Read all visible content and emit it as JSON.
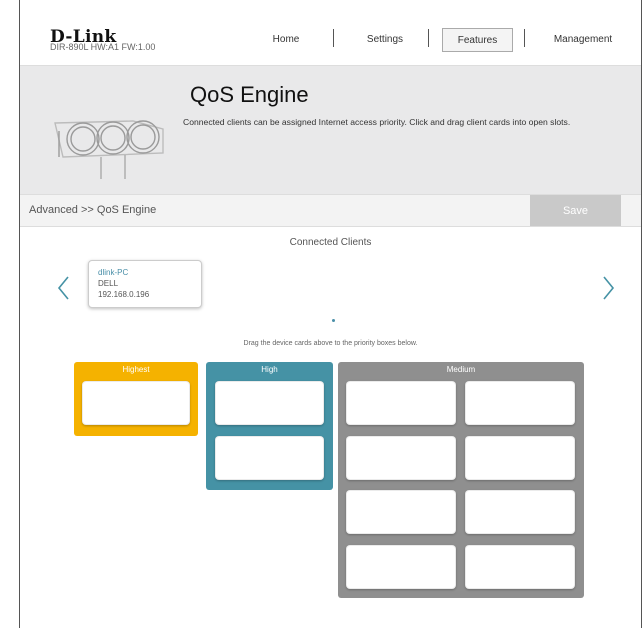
{
  "header": {
    "brand": "D-Link",
    "model_info": "DIR-890L   HW:A1   FW:1.00",
    "nav": [
      {
        "label": "Home"
      },
      {
        "label": "Settings"
      },
      {
        "label": "Features",
        "active": true
      },
      {
        "label": "Management"
      }
    ]
  },
  "banner": {
    "title": "QoS Engine",
    "description": "Connected clients can be assigned Internet access priority. Click and drag client cards into open slots."
  },
  "breadcrumb": "Advanced >> QoS Engine",
  "save_label": "Save",
  "clients": {
    "title": "Connected Clients",
    "items": [
      {
        "name": "dlink-PC",
        "vendor": "DELL",
        "ip": "192.168.0.196"
      }
    ],
    "hint": "Drag the device cards above to the priority boxes below."
  },
  "priorities": {
    "highest": {
      "label": "Highest",
      "color": "#f5b200"
    },
    "high": {
      "label": "High",
      "color": "#4592a5"
    },
    "medium": {
      "label": "Medium",
      "color": "#8f8f8f"
    }
  },
  "icons": {
    "prev": "chevron-left-icon",
    "next": "chevron-right-icon",
    "banner": "qos-engine-illustration-icon"
  },
  "colors": {
    "accent": "#4592a5",
    "save_disabled": "#c9c9c9"
  }
}
